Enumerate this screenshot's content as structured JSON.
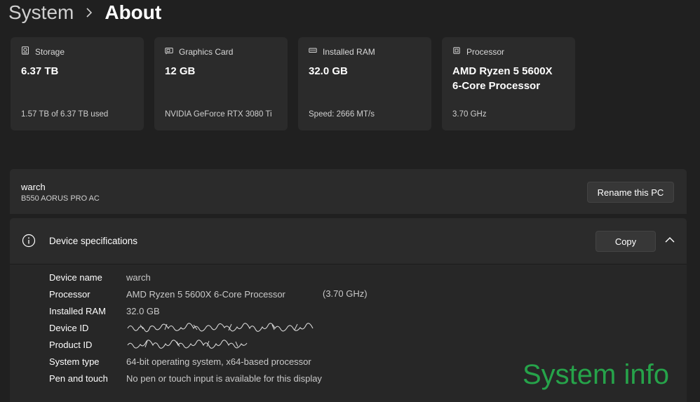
{
  "breadcrumb": {
    "parent": "System",
    "current": "About"
  },
  "cards": [
    {
      "icon": "storage-icon",
      "title": "Storage",
      "value": "6.37 TB",
      "sub": "1.57 TB of 6.37 TB used"
    },
    {
      "icon": "graphics-card-icon",
      "title": "Graphics Card",
      "value": "12 GB",
      "sub": "NVIDIA GeForce RTX 3080 Ti"
    },
    {
      "icon": "ram-icon",
      "title": "Installed RAM",
      "value": "32.0 GB",
      "sub": "Speed: 2666 MT/s"
    },
    {
      "icon": "processor-icon",
      "title": "Processor",
      "value": "AMD Ryzen 5 5600X\n6-Core Processor",
      "sub": "3.70 GHz"
    }
  ],
  "pc": {
    "name": "warch",
    "model": "B550 AORUS PRO AC",
    "rename_label": "Rename this PC"
  },
  "specs": {
    "title": "Device specifications",
    "copy_label": "Copy",
    "rows": [
      {
        "label": "Device name",
        "value": "warch"
      },
      {
        "label": "Processor",
        "value": "AMD Ryzen 5 5600X 6-Core Processor",
        "extra": "(3.70 GHz)"
      },
      {
        "label": "Installed RAM",
        "value": "32.0 GB"
      },
      {
        "label": "Device ID",
        "value": ""
      },
      {
        "label": "Product ID",
        "value": ""
      },
      {
        "label": "System type",
        "value": "64-bit operating system, x64-based processor"
      },
      {
        "label": "Pen and touch",
        "value": "No pen or touch input is available for this display"
      }
    ]
  },
  "watermark": "System info",
  "colors": {
    "background": "#202020",
    "card": "#2b2b2b",
    "watermark": "#26a34a"
  }
}
